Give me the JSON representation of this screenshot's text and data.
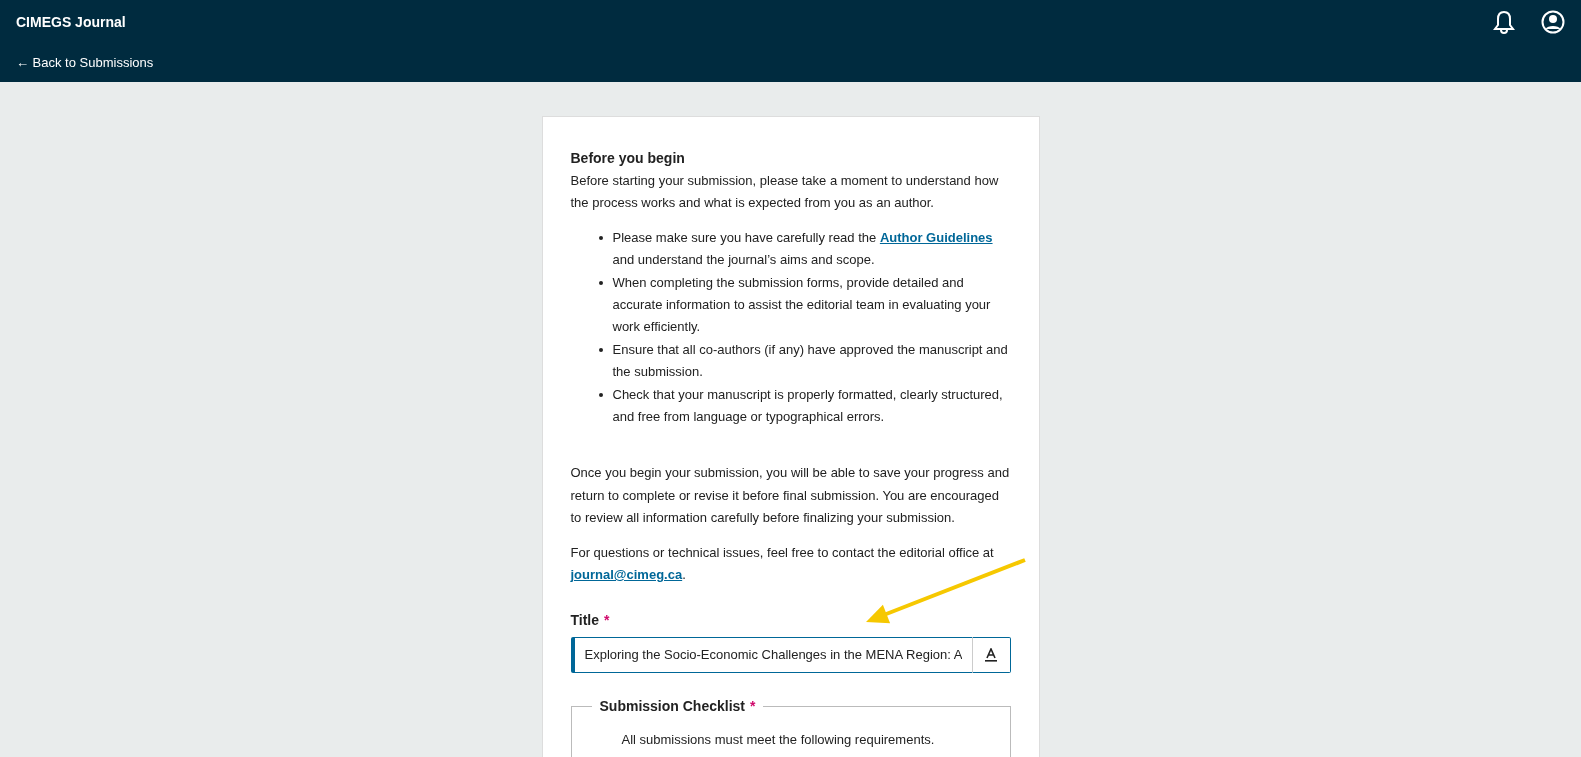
{
  "header": {
    "site_title": "CIMEGS Journal",
    "back_link": "← Back to Submissions"
  },
  "intro": {
    "heading": "Before you begin",
    "paragraph": "Before starting your submission, please take a moment to understand how the process works and what is expected from you as an author.",
    "bullets": [
      {
        "before": "Please make sure you have carefully read the ",
        "link": "Author Guidelines",
        "after": " and understand the journal’s aims and scope."
      },
      {
        "before": "When completing the submission forms, provide detailed and accurate information to assist the editorial team in evaluating your work efficiently."
      },
      {
        "before": "Ensure that all co-authors (if any) have approved the manuscript and the submission."
      },
      {
        "before": "Check that your manuscript is properly formatted, clearly structured, and free from language or typographical errors."
      }
    ],
    "paragraphs": [
      {
        "before": "Once you begin your submission, you will be able to save your progress and return to complete or revise it before final submission. You are encouraged to review all information carefully before finalizing your submission."
      },
      {
        "before": "For questions or technical issues, feel free to contact the editorial office at ",
        "link": "journal@cimeg.ca",
        "after": "."
      }
    ]
  },
  "title_field": {
    "label": "Title",
    "required_mark": "*",
    "value": "Exploring the Socio-Economic Challenges in the MENA Region: A"
  },
  "checklist": {
    "legend": "Submission Checklist",
    "required_mark": "*",
    "text": "All submissions must meet the following requirements."
  }
}
